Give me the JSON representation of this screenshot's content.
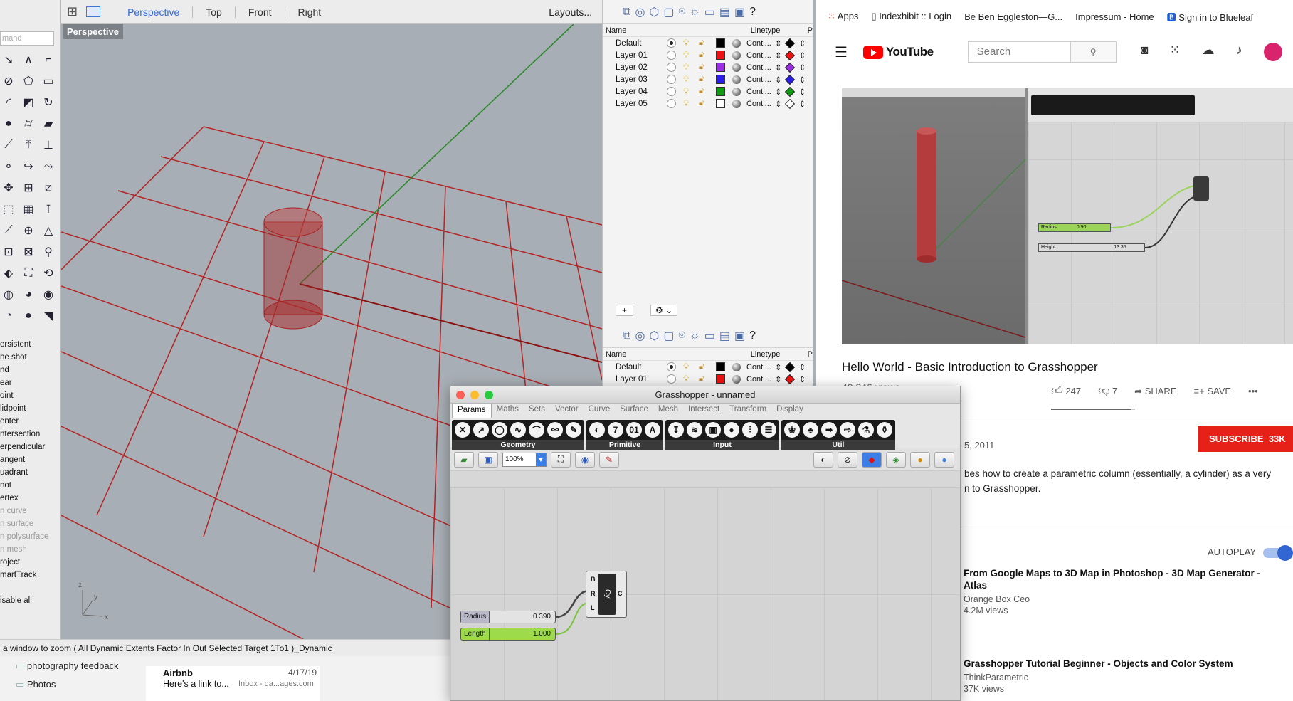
{
  "rhino": {
    "search_placeholder": "mand",
    "viewport_tabs": [
      "Perspective",
      "Top",
      "Front",
      "Right"
    ],
    "layouts_label": "Layouts...",
    "viewport_label": "Perspective",
    "snaps": [
      {
        "label": "ersistent",
        "enabled": true
      },
      {
        "label": "ne shot",
        "enabled": true
      },
      {
        "label": "nd",
        "enabled": true
      },
      {
        "label": "ear",
        "enabled": true
      },
      {
        "label": "oint",
        "enabled": true
      },
      {
        "label": "lidpoint",
        "enabled": true
      },
      {
        "label": "enter",
        "enabled": true
      },
      {
        "label": "ntersection",
        "enabled": true
      },
      {
        "label": "erpendicular",
        "enabled": true
      },
      {
        "label": "angent",
        "enabled": true
      },
      {
        "label": "uadrant",
        "enabled": true
      },
      {
        "label": "not",
        "enabled": true
      },
      {
        "label": "ertex",
        "enabled": true
      },
      {
        "label": "n curve",
        "enabled": false
      },
      {
        "label": "n surface",
        "enabled": false
      },
      {
        "label": "n polysurface",
        "enabled": false
      },
      {
        "label": "n mesh",
        "enabled": false
      },
      {
        "label": "roject",
        "enabled": true
      },
      {
        "label": "martTrack",
        "enabled": true
      },
      {
        "label": "",
        "enabled": true
      },
      {
        "label": "isable all",
        "enabled": true
      }
    ],
    "command_line": "a window to zoom ( All Dynamic Extents Factor In Out Selected Target 1To1 )_Dynamic",
    "axis_labels": {
      "z": "z",
      "y": "y",
      "x": "x"
    }
  },
  "layers_panel": {
    "col_name": "Name",
    "col_linetype": "Linetype",
    "col_p": "P",
    "layers": [
      {
        "name": "Default",
        "color": "#000000",
        "linetype": "Conti...",
        "print_color": "#000000",
        "current": true
      },
      {
        "name": "Layer 01",
        "color": "#ee1111",
        "linetype": "Conti...",
        "print_color": "#ee1111",
        "current": false
      },
      {
        "name": "Layer 02",
        "color": "#9a2ee0",
        "linetype": "Conti...",
        "print_color": "#9a2ee0",
        "current": false
      },
      {
        "name": "Layer 03",
        "color": "#2a1ee8",
        "linetype": "Conti...",
        "print_color": "#2a1ee8",
        "current": false
      },
      {
        "name": "Layer 04",
        "color": "#139a13",
        "linetype": "Conti...",
        "print_color": "#139a13",
        "current": false
      },
      {
        "name": "Layer 05",
        "color": "#ffffff",
        "linetype": "Conti...",
        "print_color": "#ffffff",
        "current": false
      }
    ],
    "layers_lower": [
      {
        "name": "Default",
        "color": "#000000",
        "linetype": "Conti...",
        "print_color": "#000000",
        "current": true
      },
      {
        "name": "Layer 01",
        "color": "#ee1111",
        "linetype": "Conti...",
        "print_color": "#ee1111",
        "current": false
      }
    ],
    "add_label": "+",
    "remove_label": "−"
  },
  "grasshopper": {
    "title": "Grasshopper - unnamed",
    "tabs": [
      "Params",
      "Maths",
      "Sets",
      "Vector",
      "Curve",
      "Surface",
      "Mesh",
      "Intersect",
      "Transform",
      "Display"
    ],
    "ribbon_groups": [
      {
        "label": "Geometry",
        "icons": [
          "✕",
          "↗",
          "◯",
          "∿",
          "⌒",
          "⚯",
          "✎"
        ]
      },
      {
        "label": "Primitive",
        "icons": [
          "◐",
          "7",
          "01",
          "A"
        ]
      },
      {
        "label": "Input",
        "icons": [
          "↧",
          "≋",
          "▣",
          "●",
          "⫶",
          "☰"
        ]
      },
      {
        "label": "Util",
        "icons": [
          "❀",
          "♣",
          "➡",
          "⇨",
          "⚗",
          "⚱"
        ]
      }
    ],
    "zoom": "100%",
    "sliders": [
      {
        "label": "Radius",
        "value": "0.390"
      },
      {
        "label": "Length",
        "value": "1.000"
      }
    ],
    "component": {
      "inputs": [
        "B",
        "R",
        "L"
      ],
      "output": "C",
      "name": "Cyl"
    }
  },
  "mail": {
    "folders": [
      "photography feedback",
      "Photos"
    ],
    "message": {
      "sender": "Airbnb",
      "date": "4/17/19",
      "subject": "Here's a link to...",
      "preview": "Inbox - da...ages.com"
    }
  },
  "browser": {
    "bookmarks": [
      {
        "icon": "apps-icon",
        "label": "Apps"
      },
      {
        "icon": "page-icon",
        "label": "Indexhibit :: Login"
      },
      {
        "icon": "be-icon",
        "label": "Ben Eggleston—G..."
      },
      {
        "icon": "",
        "label": "Impressum - Home"
      },
      {
        "icon": "b-icon",
        "label": "Sign in to Blueleaf"
      }
    ],
    "youtube": {
      "logo": "YouTube",
      "search_placeholder": "Search",
      "video_title": "Hello World - Basic Introduction to Grasshopper",
      "views_partial": "40,346 views",
      "likes": "247",
      "dislikes": "7",
      "share_label": "SHARE",
      "save_label": "SAVE",
      "more_label": "•••",
      "date_partial": "5, 2011",
      "description_l1": "bes how to create a parametric column (essentially, a cylinder) as a very",
      "description_l2": "n to Grasshopper.",
      "subscribe_label": "SUBSCRIBE",
      "subscribers": "33K",
      "autoplay_label": "AUTOPLAY",
      "thumb_sliders": [
        {
          "label": "Radius",
          "value": "0.90"
        },
        {
          "label": "Height",
          "value": "13.35"
        }
      ],
      "recommended": [
        {
          "title": "From Google Maps to 3D Map in Photoshop - 3D Map Generator - Atlas",
          "channel": "Orange Box Ceo",
          "views": "4.2M views"
        },
        {
          "title": "Grasshopper Tutorial Beginner - Objects and Color System",
          "channel": "ThinkParametric",
          "views": "37K views"
        }
      ]
    }
  }
}
